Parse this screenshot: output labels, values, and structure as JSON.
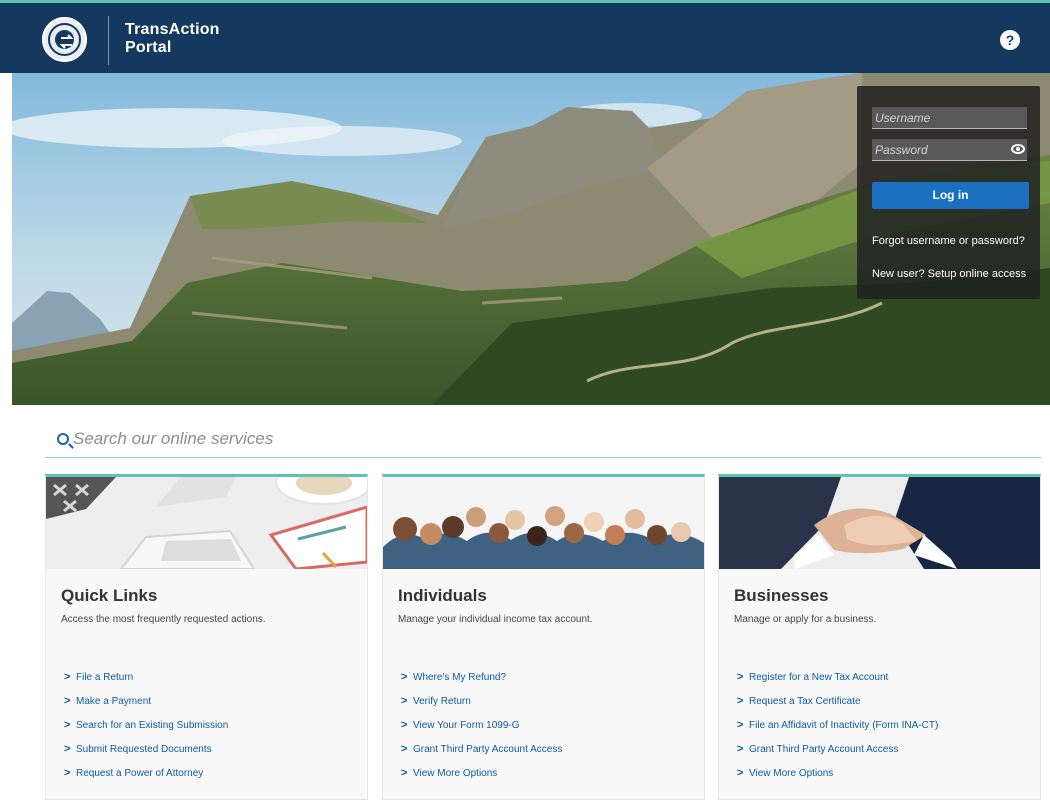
{
  "header": {
    "title_line1": "TransAction",
    "title_line2": "Portal",
    "help_symbol": "?",
    "colors": {
      "header_bg": "#14385e",
      "accent": "#5fc3b0",
      "link": "#0c5a9c",
      "button": "#1a6fc0"
    }
  },
  "hero": {
    "scene": "mountain-landscape-photo"
  },
  "login": {
    "username_placeholder": "Username",
    "password_placeholder": "Password",
    "login_label": "Log in",
    "forgot_link": "Forgot username or password?",
    "new_user_link": "New user? Setup online access",
    "password_toggle_icon": "eye-icon"
  },
  "search": {
    "placeholder": "Search our online services",
    "icon": "search-icon"
  },
  "cards": [
    {
      "title": "Quick Links",
      "description": "Access the most frequently requested actions.",
      "image": "laptop-desk-photo",
      "links": [
        "File a Return",
        "Make a Payment",
        "Search for an Existing Submission",
        "Submit Requested Documents",
        "Request a Power of Attorney"
      ]
    },
    {
      "title": "Individuals",
      "description": "Manage your individual income tax account.",
      "image": "group-of-people-photo",
      "links": [
        "Where's My Refund?",
        "Verify Return",
        "View Your Form 1099-G",
        "Grant Third Party Account Access",
        "View More Options"
      ]
    },
    {
      "title": "Businesses",
      "description": "Manage or apply for a business.",
      "image": "handshake-photo",
      "links": [
        "Register for a New Tax Account",
        "Request a Tax Certificate",
        "File an Affidavit of Inactivity (Form INA-CT)",
        "Grant Third Party Account Access",
        "View More Options"
      ]
    }
  ]
}
